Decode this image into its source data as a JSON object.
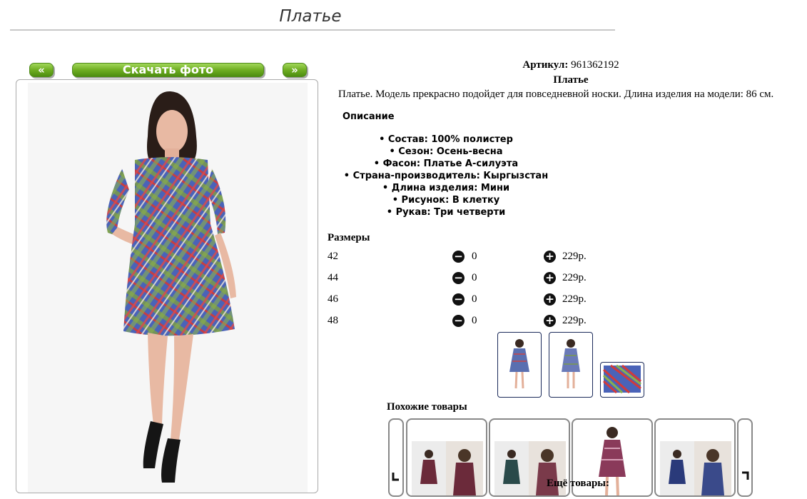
{
  "page": {
    "title": "Платье"
  },
  "gallery": {
    "prev_label": "«",
    "download_label": "Скачать фото",
    "next_label": "»",
    "main_photo_icon": "dress-photo"
  },
  "product": {
    "article_label": "Артикул:",
    "article_value": "961362192",
    "name": "Платье",
    "description": "Платье. Модель прекрасно подойдет для повседневной носки. Длина изделия на модели: 86 см.",
    "details_heading": "Описание",
    "attributes": [
      "• Состав: 100% полистер",
      "• Сезон: Осень-весна",
      "• Фасон: Платье А-силуэта",
      "• Страна-производитель: Кыргызстан",
      "• Длина изделия: Мини",
      "• Рисунок: В клетку",
      "• Рукав: Три четверти"
    ]
  },
  "sizes": {
    "heading": "Размеры",
    "rows": [
      {
        "size": "42",
        "qty": "0",
        "price": "229р."
      },
      {
        "size": "44",
        "qty": "0",
        "price": "229р."
      },
      {
        "size": "46",
        "qty": "0",
        "price": "229р."
      },
      {
        "size": "48",
        "qty": "0",
        "price": "229р."
      }
    ]
  },
  "similar": {
    "heading": "Похожие товары",
    "more_label": "Ещё товары:"
  },
  "colors": {
    "accent_green": "#6fae22",
    "thumb_border": "#1b2a5a",
    "title_gray": "#333333"
  }
}
